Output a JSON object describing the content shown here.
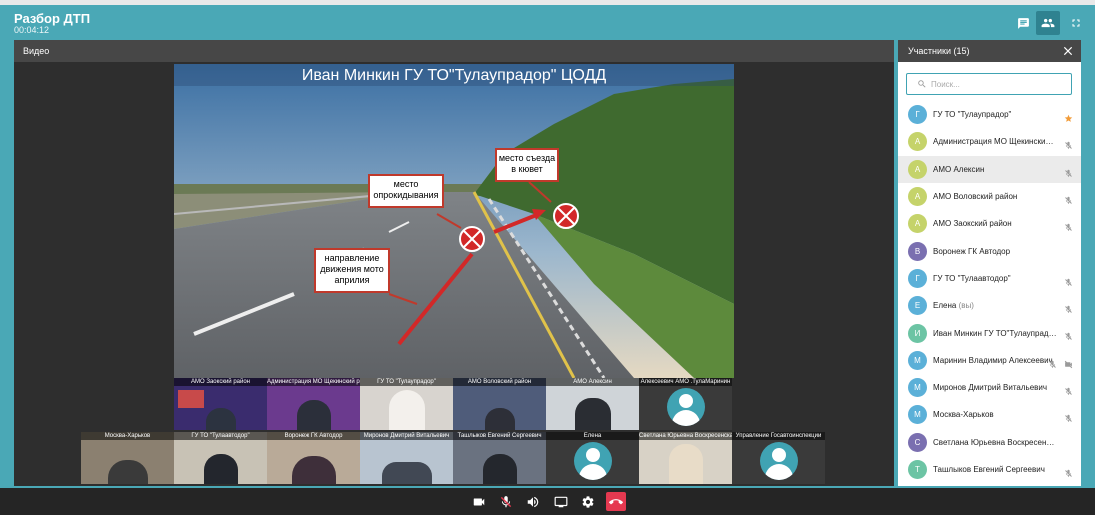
{
  "header": {
    "title": "Разбор ДТП",
    "timer": "00:04:12"
  },
  "topbar_icons": [
    "chat-icon",
    "participants-icon",
    "fullscreen-icon"
  ],
  "video_panel": {
    "title": "Видео",
    "main_stream": {
      "slide_title": "Иван Минкин  ГУ ТО\"Тулаупрадор\" ЦОДД",
      "callouts": {
        "rollover": "место опрокидывания",
        "exit": "место съезда в кювет",
        "direction": "направление движения мото априлия"
      }
    },
    "thumbnails_row1": [
      "АМО Заокский район",
      "Администрация МО Щекинский район",
      "ГУ ТО \"Тулаупрадор\"",
      "АМО Воловский район",
      "АМО Алексин",
      "Алексеевич АМО .ТулаМаринин"
    ],
    "thumbnails_row2": [
      "Москва-Харьков",
      "ГУ ТО \"Тулаавтодор\"",
      "Воронеж ГК Автодор",
      "Миронов Дмитрий Витальевич",
      "Ташлыков Евгений Сергеевич",
      "Елена",
      "Светлана Юрьевна Воскресенская",
      "Управление Госавтоинспекции"
    ]
  },
  "participants": {
    "title": "Участники (15)",
    "search_placeholder": "Поиск...",
    "list": [
      {
        "initial": "Г",
        "name": "ГУ ТО \"Тулаупрадор\"",
        "color": "#5bb0d8",
        "status": "star"
      },
      {
        "initial": "А",
        "name": "Администрация МО Щекинский район",
        "color": "#c5d36a",
        "status": "muted"
      },
      {
        "initial": "А",
        "name": "АМО Алексин",
        "color": "#c5d36a",
        "status": "muted",
        "highlighted": true
      },
      {
        "initial": "А",
        "name": "АМО Воловский район",
        "color": "#c5d36a",
        "status": "muted"
      },
      {
        "initial": "А",
        "name": "АМО Заокский район",
        "color": "#c5d36a",
        "status": "muted"
      },
      {
        "initial": "В",
        "name": "Воронеж ГК Автодор",
        "color": "#7a6fb0",
        "status": "none"
      },
      {
        "initial": "Г",
        "name": "ГУ ТО \"Тулаавтодор\"",
        "color": "#5bb0d8",
        "status": "muted"
      },
      {
        "initial": "Е",
        "name": "Елена",
        "suffix": "(вы)",
        "color": "#5bb0d8",
        "status": "muted"
      },
      {
        "initial": "И",
        "name": "Иван Минкин ГУ ТО\"Тулаупрадор\" ЦОДД",
        "color": "#6cc4a4",
        "status": "muted"
      },
      {
        "initial": "М",
        "name": "Маринин Владимир Алексеевич",
        "color": "#5bb0d8",
        "status": "muted-video"
      },
      {
        "initial": "М",
        "name": "Миронов Дмитрий Витальевич",
        "color": "#5bb0d8",
        "status": "muted"
      },
      {
        "initial": "М",
        "name": "Москва-Харьков",
        "color": "#5bb0d8",
        "status": "muted"
      },
      {
        "initial": "С",
        "name": "Светлана Юрьевна Воскресенская",
        "color": "#7a6fb0",
        "status": "none"
      },
      {
        "initial": "Т",
        "name": "Ташлыков Евгений Сергеевич",
        "color": "#6cc4a4",
        "status": "muted"
      }
    ]
  },
  "controls": [
    "camera-icon",
    "mic-muted-icon",
    "speaker-icon",
    "screen-share-icon",
    "settings-icon",
    "hangup-icon"
  ],
  "colors": {
    "accent": "#40a3b3",
    "hangup": "#e53950",
    "star": "#f29b37",
    "callout_border": "#c0392b"
  }
}
